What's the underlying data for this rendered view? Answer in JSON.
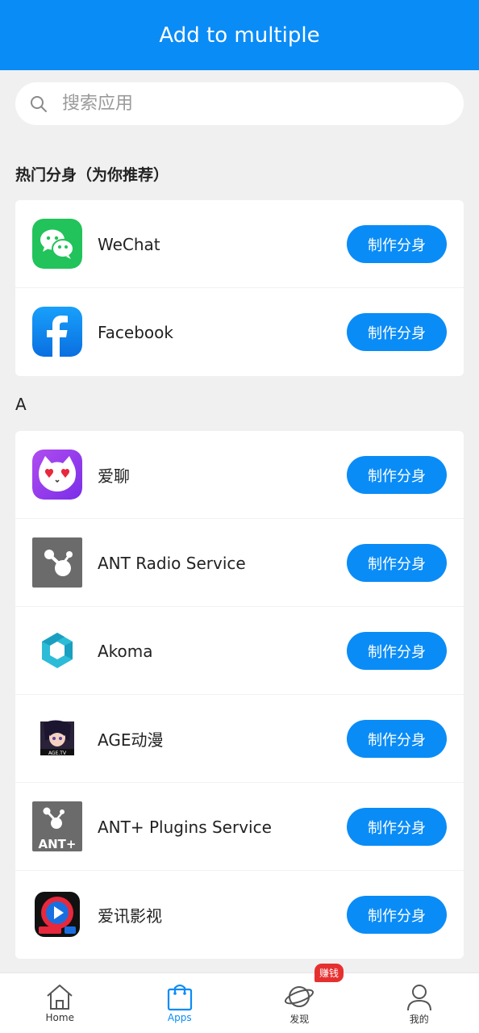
{
  "header": {
    "title": "Add to multiple"
  },
  "search": {
    "placeholder": "搜索应用",
    "value": ""
  },
  "hot_section": {
    "title": "热门分身（为你推荐）",
    "items": [
      {
        "name": "WeChat",
        "icon": "wechat-icon",
        "button": "制作分身"
      },
      {
        "name": "Facebook",
        "icon": "facebook-icon",
        "button": "制作分身"
      }
    ]
  },
  "section_a": {
    "letter": "A",
    "items": [
      {
        "name": "爱聊",
        "icon": "ailiao-icon",
        "button": "制作分身"
      },
      {
        "name": "ANT Radio Service",
        "icon": "ant-radio-icon",
        "button": "制作分身"
      },
      {
        "name": "Akoma",
        "icon": "akoma-icon",
        "button": "制作分身"
      },
      {
        "name": "AGE动漫",
        "icon": "age-anime-icon",
        "button": "制作分身"
      },
      {
        "name": "ANT+ Plugins Service",
        "icon": "ant-plugins-icon",
        "button": "制作分身"
      },
      {
        "name": "爱讯影视",
        "icon": "aixun-video-icon",
        "button": "制作分身"
      }
    ]
  },
  "bottom_nav": {
    "items": [
      {
        "label": "Home",
        "icon": "home-icon",
        "active": false
      },
      {
        "label": "Apps",
        "icon": "apps-bag-icon",
        "active": true
      },
      {
        "label": "发现",
        "icon": "discover-planet-icon",
        "active": false,
        "badge": "赚钱"
      },
      {
        "label": "我的",
        "icon": "profile-icon",
        "active": false
      }
    ]
  },
  "colors": {
    "primary": "#0a8cf7",
    "background": "#f0f0f0",
    "badge": "#e63030"
  },
  "icon_text": {
    "age": "AGE.TV",
    "ant_plus": "ANT+"
  }
}
